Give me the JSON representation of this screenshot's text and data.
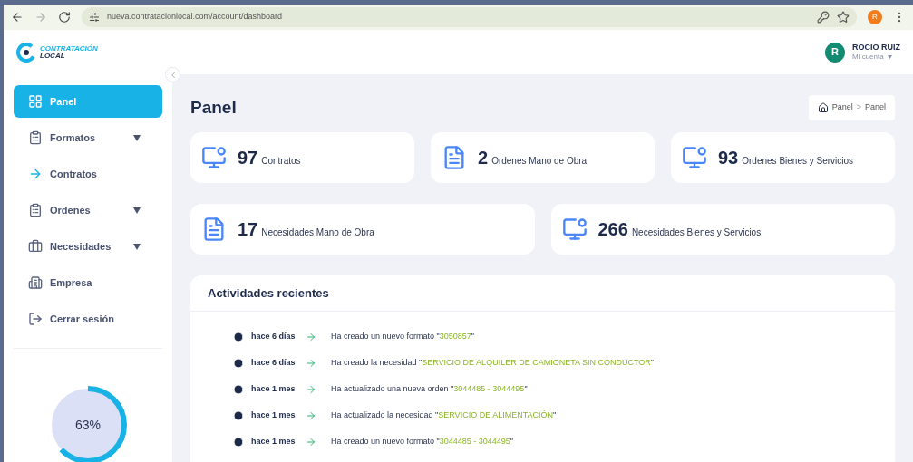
{
  "browser": {
    "url": "nueva.contratacionlocal.com/account/dashboard",
    "profile_initial": "R"
  },
  "logo": {
    "line_1": "CONTRATACIÓN",
    "line_2": "LOCAL"
  },
  "user": {
    "initial": "R",
    "name": "ROCIO RUIZ",
    "menu": "Mi cuenta"
  },
  "sidebar": {
    "items": [
      {
        "label": "Panel",
        "kind": "grid",
        "selected": true,
        "submenu": false
      },
      {
        "label": "Formatos",
        "kind": "clipboard",
        "selected": false,
        "submenu": true
      },
      {
        "label": "Contratos",
        "kind": "arrow",
        "selected": false,
        "submenu": false
      },
      {
        "label": "Ordenes",
        "kind": "clipboard",
        "selected": false,
        "submenu": true
      },
      {
        "label": "Necesidades",
        "kind": "briefcase",
        "selected": false,
        "submenu": true
      },
      {
        "label": "Empresa",
        "kind": "building",
        "selected": false,
        "submenu": false
      },
      {
        "label": "Cerrar sesión",
        "kind": "logout",
        "selected": false,
        "submenu": false
      }
    ],
    "progress": {
      "level": 0.63,
      "reading": "63%"
    }
  },
  "page": {
    "title": "Panel",
    "breadcrumb": [
      "Panel",
      "Panel"
    ],
    "breadcrumb_separator": ">"
  },
  "stats": [
    [
      {
        "value": "97",
        "label": "Contratos",
        "kind": "monitor"
      },
      {
        "value": "2",
        "label": "Ordenes Mano de Obra",
        "kind": "document"
      },
      {
        "value": "93",
        "label": "Ordenes Bienes y Servicios",
        "kind": "monitor"
      }
    ],
    [
      {
        "value": "17",
        "label": "Necesidades Mano de Obra",
        "kind": "document"
      },
      {
        "value": "266",
        "label": "Necesidades Bienes y Servicios",
        "kind": "monitor"
      }
    ]
  ],
  "activities": {
    "title": "Actividades recientes",
    "items": [
      {
        "time": "hace 6 días",
        "action": "Ha creado un nuevo formato \"",
        "target": "3050857",
        "close": "\""
      },
      {
        "time": "hace 6 días",
        "action": "Ha creado la necesidad \"",
        "target": "SERVICIO DE ALQUILER DE CAMIONETA SIN CONDUCTOR",
        "close": "\""
      },
      {
        "time": "hace 1 mes",
        "action": "Ha actualizado una nueva orden \"",
        "target": "3044485 - 3044495",
        "close": "\""
      },
      {
        "time": "hace 1 mes",
        "action": "Ha actualizado la necesidad \"",
        "target": "SERVICIO DE ALIMENTACIÓN",
        "close": "\""
      },
      {
        "time": "hace 1 mes",
        "action": "Ha creado un nuevo formato \"",
        "target": "3044485 - 3044495",
        "close": "\""
      }
    ]
  }
}
